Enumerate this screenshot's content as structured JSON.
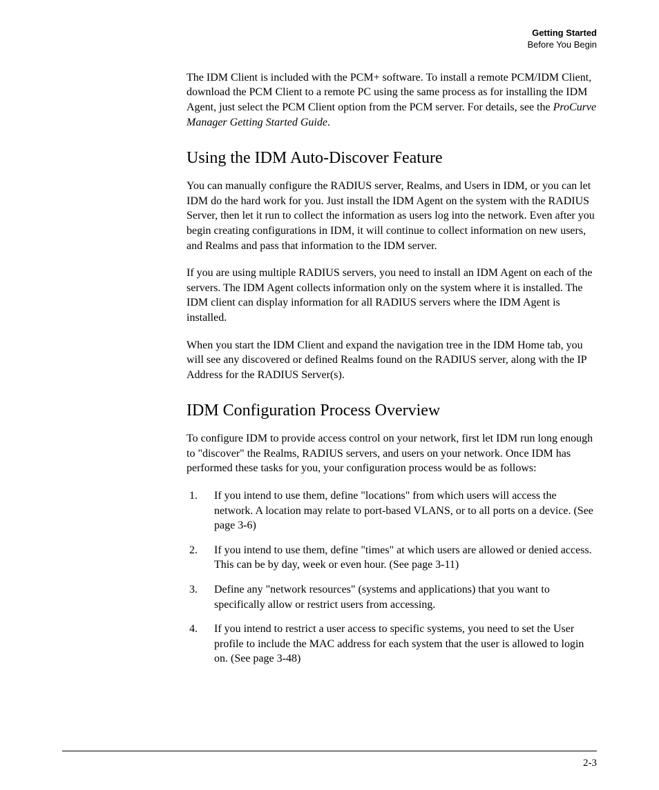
{
  "header": {
    "title": "Getting Started",
    "subtitle": "Before You Begin"
  },
  "intro_para_pre": "The IDM Client is included with the PCM+ software. To install a remote PCM/IDM Client, download the PCM Client to a remote PC using the same process as for installing the IDM Agent, just select the PCM Client option from the PCM server. For details, see the ",
  "intro_para_italic": "ProCurve Manager Getting Started Guide",
  "intro_para_post": ".",
  "section1": {
    "heading": "Using the IDM Auto-Discover Feature",
    "p1": "You can manually configure the RADIUS server, Realms, and Users in IDM, or you can let IDM do the hard work for you. Just install the IDM Agent on the system with the RADIUS Server, then let it run to collect the information as users log into the network. Even after you begin creating configurations in IDM, it will continue to collect information on new users, and Realms and pass that information to the IDM server.",
    "p2": "If you are using multiple RADIUS servers, you need to install an IDM Agent on each of the servers. The IDM Agent collects information only on the system where it is installed. The IDM client can display information for all RADIUS servers where the IDM Agent is installed.",
    "p3": "When you start the IDM Client and expand the navigation tree in the IDM Home tab, you will see any discovered or defined Realms found on the RADIUS server, along with the IP Address for the RADIUS Server(s)."
  },
  "section2": {
    "heading": "IDM Configuration Process Overview",
    "intro": "To configure IDM to provide access control on your network, first let IDM run long enough to \"discover\" the Realms, RADIUS servers, and users on your network. Once IDM has performed these tasks for you, your configuration process would be as follows:",
    "steps": [
      "If you intend to use them, define \"locations\" from which users will access the network. A location may relate to port-based VLANS, or to all ports on a device. (See page 3-6)",
      "If you intend to use them, define \"times\" at which users are allowed or denied access. This can be by day, week or even hour. (See page 3-11)",
      "Define any \"network resources\" (systems and applications) that you want to specifically allow or restrict users from accessing.",
      "If you intend to restrict a user access to specific systems, you need to set the User profile to include the MAC address for each system that the user is allowed to login on. (See page 3-48)"
    ]
  },
  "page_number": "2-3"
}
